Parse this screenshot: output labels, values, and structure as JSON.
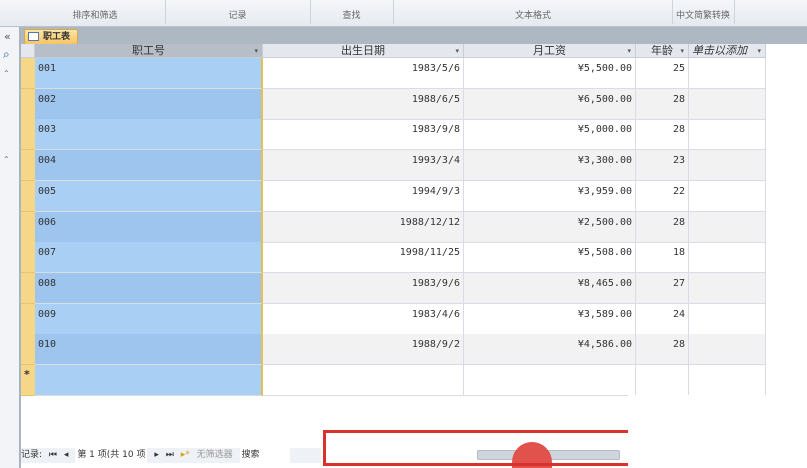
{
  "ribbon": {
    "groups": [
      "排序和筛选",
      "记录",
      "查找",
      "文本格式",
      "中文简繁转换"
    ]
  },
  "tab": {
    "label": "职工表"
  },
  "columns": [
    "职工号",
    "出生日期",
    "月工资",
    "年龄",
    "单击以添加"
  ],
  "rows": [
    [
      "001",
      "1983/5/6",
      "¥5,500.00",
      "25"
    ],
    [
      "002",
      "1988/6/5",
      "¥6,500.00",
      "28"
    ],
    [
      "003",
      "1983/9/8",
      "¥5,000.00",
      "28"
    ],
    [
      "004",
      "1993/3/4",
      "¥3,300.00",
      "23"
    ],
    [
      "005",
      "1994/9/3",
      "¥3,959.00",
      "22"
    ],
    [
      "006",
      "1988/12/12",
      "¥2,500.00",
      "28"
    ],
    [
      "007",
      "1998/11/25",
      "¥5,508.00",
      "18"
    ],
    [
      "008",
      "1983/9/6",
      "¥8,465.00",
      "27"
    ],
    [
      "009",
      "1983/4/6",
      "¥3,589.00",
      "24"
    ],
    [
      "010",
      "1988/9/2",
      "¥4,586.00",
      "28"
    ]
  ],
  "new_row_marker": "*",
  "nav": {
    "label": "记录:",
    "first": "⏮",
    "prev": "◂",
    "position": "第 1 项(共 10 项",
    "next": "▸",
    "last": "⏭",
    "new": "▸*",
    "filter": "无筛选器",
    "search": "搜索"
  },
  "leftbar": {
    "collapse": "«",
    "search_icon": "⌕"
  }
}
